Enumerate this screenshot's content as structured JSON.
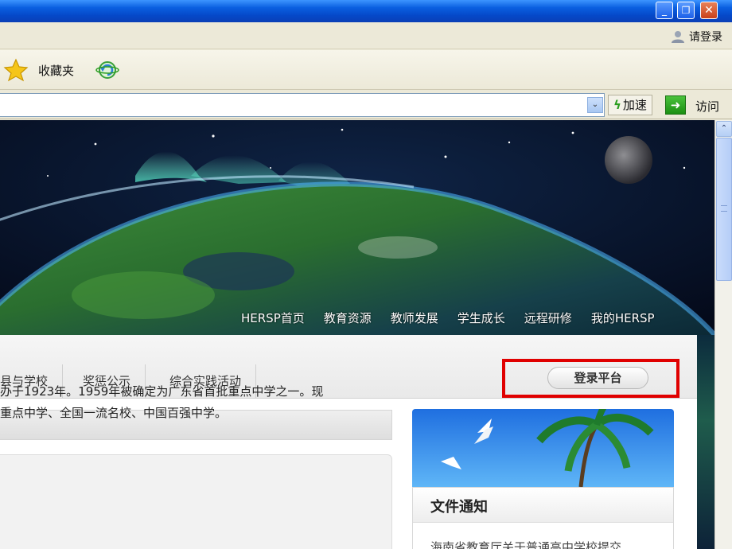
{
  "window": {
    "minimize_glyph": "_",
    "restore_glyph": "❐",
    "close_glyph": "✕"
  },
  "loginbar": {
    "login_label": "请登录",
    "icon": "user-icon"
  },
  "favorites": {
    "label": "收藏夹",
    "icons": [
      "star-icon",
      "ie-refresh-icon"
    ]
  },
  "address": {
    "url": "",
    "dropdown_glyph": "⌄",
    "speed_label": "加速",
    "go_label": "访问",
    "go_glyph": "➜"
  },
  "site": {
    "top_nav": [
      "HERSP首页",
      "教育资源",
      "教师发展",
      "学生成长",
      "远程研修",
      "我的HERSP"
    ],
    "tabs": [
      "县与学校",
      "奖惩公示",
      "综合实践活动"
    ],
    "login_platform": "登录平台",
    "intro_lines": [
      "办于1923年。1959年被确定为广东省首批重点中学之一。现",
      "重点中学、全国一流名校、中国百强中学。"
    ],
    "notice": {
      "title": "文件通知",
      "first_item": "海南省教育厅关于普通高中学校提交"
    }
  },
  "colors": {
    "titlebar": "#0a5fe0",
    "highlight": "#e00000",
    "panel_bg": "#ffffff"
  },
  "scrollbar": {
    "up_glyph": "⌃"
  }
}
